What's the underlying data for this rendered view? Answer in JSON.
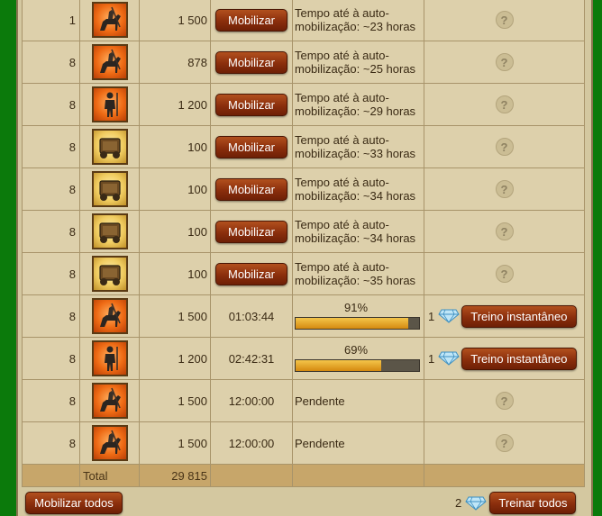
{
  "colors": {
    "accent_button": "#8a2e0c",
    "background": "#0b7a0b",
    "panel": "#ddd0ab",
    "total_row": "#c7a66a",
    "progress_fill": "#e8a920"
  },
  "rows": [
    {
      "level": "1",
      "unit": "cavalry-icon",
      "count": "1 500",
      "kind": "mobilize",
      "action": "Mobilizar",
      "info": "Tempo até à auto-mobilização: ~23 horas",
      "end": "?"
    },
    {
      "level": "8",
      "unit": "cavalry-icon",
      "count": "878",
      "kind": "mobilize",
      "action": "Mobilizar",
      "info": "Tempo até à auto-mobilização: ~25 horas",
      "end": "?"
    },
    {
      "level": "8",
      "unit": "infantry-icon",
      "count": "1 200",
      "kind": "mobilize",
      "action": "Mobilizar",
      "info": "Tempo até à auto-mobilização: ~29 horas",
      "end": "?"
    },
    {
      "level": "8",
      "unit": "cart-icon",
      "count": "100",
      "kind": "mobilize",
      "action": "Mobilizar",
      "info": "Tempo até à auto-mobilização: ~33 horas",
      "end": "?"
    },
    {
      "level": "8",
      "unit": "cart-icon",
      "count": "100",
      "kind": "mobilize",
      "action": "Mobilizar",
      "info": "Tempo até à auto-mobilização: ~34 horas",
      "end": "?"
    },
    {
      "level": "8",
      "unit": "cart-icon",
      "count": "100",
      "kind": "mobilize",
      "action": "Mobilizar",
      "info": "Tempo até à auto-mobilização: ~34 horas",
      "end": "?"
    },
    {
      "level": "8",
      "unit": "cart-icon",
      "count": "100",
      "kind": "mobilize",
      "action": "Mobilizar",
      "info": "Tempo até à auto-mobilização: ~35 horas",
      "end": "?"
    },
    {
      "level": "8",
      "unit": "cavalry-icon",
      "count": "1 500",
      "kind": "training",
      "time": "01:03:44",
      "progress_label": "91%",
      "progress": 0.91,
      "cost": "1",
      "action": "Treino instantâneo"
    },
    {
      "level": "8",
      "unit": "infantry-icon",
      "count": "1 200",
      "kind": "training",
      "time": "02:42:31",
      "progress_label": "69%",
      "progress": 0.69,
      "cost": "1",
      "action": "Treino instantâneo"
    },
    {
      "level": "8",
      "unit": "cavalry-icon",
      "count": "1 500",
      "kind": "pending",
      "time": "12:00:00",
      "info": "Pendente",
      "end": "?"
    },
    {
      "level": "8",
      "unit": "cavalry-icon",
      "count": "1 500",
      "kind": "pending",
      "time": "12:00:00",
      "info": "Pendente",
      "end": "?"
    }
  ],
  "total": {
    "label": "Total",
    "count": "29 815"
  },
  "footer": {
    "mobilize_all": "Mobilizar todos",
    "train_all_cost": "2",
    "train_all": "Treinar todos"
  }
}
